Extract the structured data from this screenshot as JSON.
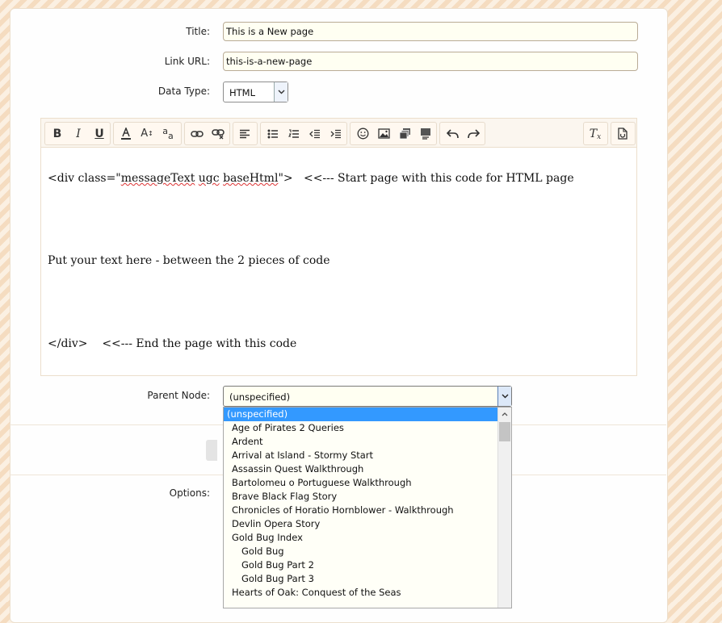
{
  "form": {
    "title_label": "Title:",
    "title_value": "This is a New page",
    "link_label": "Link URL:",
    "link_value": "this-is-a-new-page",
    "datatype_label": "Data Type:",
    "datatype_value": "HTML",
    "parent_label": "Parent Node:",
    "parent_value": "(unspecified)",
    "options_label": "Options:"
  },
  "toolbar": {
    "buttons": [
      "bold-icon",
      "italic-icon",
      "underline-icon",
      "text-color-icon",
      "font-size-icon",
      "font-family-icon",
      "link-icon",
      "unlink-icon",
      "align-icon",
      "bullet-list-icon",
      "numbered-list-icon",
      "outdent-icon",
      "indent-icon",
      "smilie-icon",
      "image-icon",
      "media-icon",
      "quote-icon",
      "undo-icon",
      "redo-icon",
      "remove-format-icon",
      "toggle-bbcode-icon"
    ]
  },
  "editor": {
    "line1_pre": "<div class=\"",
    "line1_word1": "messageText",
    "line1_mid": " ",
    "line1_word2": "ugc",
    "line1_sp": " ",
    "line1_word3": "baseHtml",
    "line1_post": "\">   <<--- Start page with this code for HTML page",
    "line2": "Put your text here - between the 2 pieces of code",
    "line3": "</div>    <<--- End the page with this code"
  },
  "dropdown": {
    "items": [
      {
        "label": "(unspecified)",
        "selected": true,
        "child": false
      },
      {
        "label": "Age of Pirates 2 Queries",
        "selected": false,
        "child": false
      },
      {
        "label": "Ardent",
        "selected": false,
        "child": false
      },
      {
        "label": "Arrival at Island - Stormy Start",
        "selected": false,
        "child": false
      },
      {
        "label": "Assassin Quest Walkthrough",
        "selected": false,
        "child": false
      },
      {
        "label": "Bartolomeu o Portuguese Walkthrough",
        "selected": false,
        "child": false
      },
      {
        "label": "Brave Black Flag Story",
        "selected": false,
        "child": false
      },
      {
        "label": "Chronicles of Horatio Hornblower - Walkthrough",
        "selected": false,
        "child": false
      },
      {
        "label": "Devlin Opera Story",
        "selected": false,
        "child": false
      },
      {
        "label": "Gold Bug Index",
        "selected": false,
        "child": false
      },
      {
        "label": "Gold Bug",
        "selected": false,
        "child": true
      },
      {
        "label": "Gold Bug Part 2",
        "selected": false,
        "child": true
      },
      {
        "label": "Gold Bug Part 3",
        "selected": false,
        "child": true
      },
      {
        "label": "Hearts of Oak: Conquest of the Seas",
        "selected": false,
        "child": false
      }
    ]
  },
  "colors": {
    "selected_bg": "#3399ff",
    "field_bg": "#fffff2"
  }
}
